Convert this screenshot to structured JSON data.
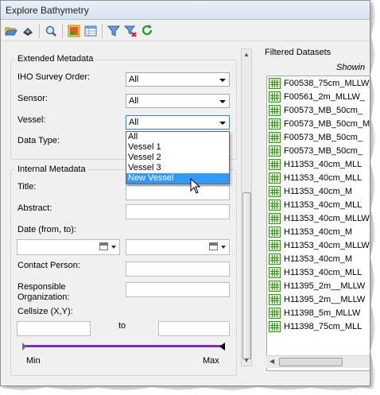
{
  "window": {
    "title": "Explore Bathymetry"
  },
  "extended": {
    "legend": "Extended Metadata",
    "fields": [
      {
        "label": "IHO Survey Order:",
        "value": "All"
      },
      {
        "label": "Sensor:",
        "value": "All"
      },
      {
        "label": "Vessel:",
        "value": "All"
      }
    ],
    "data_type_label": "Data Type:",
    "vessel_options": [
      "All",
      "Vessel 1",
      "Vessel 2",
      "Vessel 3",
      "New Vessel"
    ],
    "vessel_highlighted": "New Vessel"
  },
  "internal": {
    "legend": "Internal Metadata",
    "title_label": "Title:",
    "abstract_label": "Abstract:",
    "date_label": "Date (from, to):",
    "contact_label": "Contact Person:",
    "org_label_1": "Responsible",
    "org_label_2": "Organization:",
    "cellsize_label": "Cellsize (X,Y):",
    "to_label": "to",
    "slider_min": "Min",
    "slider_max": "Max"
  },
  "filtered": {
    "header": "Filtered Datasets",
    "showing": "Showin",
    "datasets": [
      "F00538_75cm_MLLW_",
      "F00561_2m_MLLW_",
      "F00573_MB_50cm_",
      "F00573_MB_50cm_M",
      "F00573_MB_50cm_",
      "F00573_MB_50cm_",
      "H11353_40cm_MLL",
      "H11353_40cm_MLL",
      "H11353_40cm_M",
      "H11353_40cm_MLL",
      "H11353_40cm_MLLW",
      "H11353_40cm_M",
      "H11353_40cm_MLLW",
      "H11353_40cm_M",
      "H11353_40cm_MLL",
      "H11395_2m__MLLW",
      "H11395_2m__MLLW",
      "H11398_5m_MLLW",
      "H11398_75cm_MLL"
    ]
  },
  "colors": {
    "slider": "#7a2bd0",
    "selection": "#3399ff"
  }
}
